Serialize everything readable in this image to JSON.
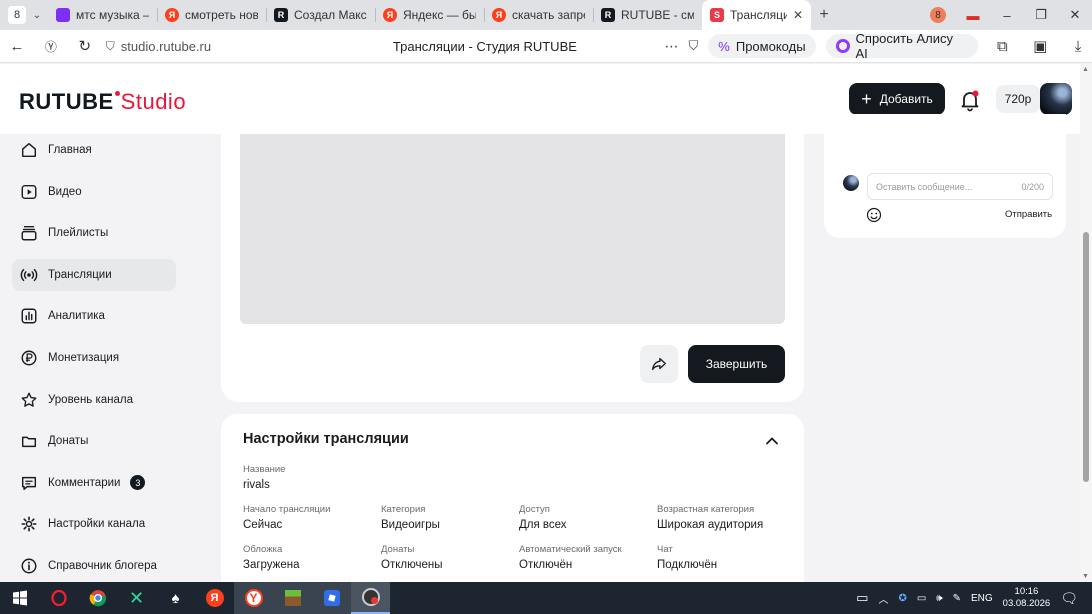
{
  "browser": {
    "tab_count": "8",
    "tabs": [
      {
        "label": "мтс музыка — Я",
        "favicon": "yandex",
        "active": false
      },
      {
        "label": "смотреть новее",
        "favicon": "yandex",
        "active": false
      },
      {
        "label": "Создал Макс к",
        "favicon": "rutube",
        "active": false
      },
      {
        "label": "Яндекс — быст",
        "favicon": "yandex",
        "active": false
      },
      {
        "label": "скачать запрет",
        "favicon": "yandex",
        "active": false
      },
      {
        "label": "RUTUBE - смот",
        "favicon": "rutube",
        "active": false
      },
      {
        "label": "Трансляции",
        "favicon": "rutube-studio",
        "active": true
      }
    ],
    "profile_letter": "8",
    "url": "studio.rutube.ru",
    "page_title": "Трансляции - Студия RUTUBE",
    "promo_label": "Промокоды",
    "alice_label": "Спросить Алису AI"
  },
  "header": {
    "logo_main": "RUTUBE",
    "logo_studio": "Studio",
    "add_label": "Добавить",
    "quality": "720p"
  },
  "sidebar": {
    "items": [
      {
        "label": "Главная",
        "icon": "home-icon"
      },
      {
        "label": "Видео",
        "icon": "video-icon"
      },
      {
        "label": "Плейлисты",
        "icon": "playlist-icon"
      },
      {
        "label": "Трансляции",
        "icon": "broadcast-icon",
        "active": true
      },
      {
        "label": "Аналитика",
        "icon": "analytics-icon"
      },
      {
        "label": "Монетизация",
        "icon": "ruble-icon"
      },
      {
        "label": "Уровень канала",
        "icon": "star-icon"
      },
      {
        "label": "Донаты",
        "icon": "gift-icon"
      },
      {
        "label": "Комментарии",
        "icon": "comment-icon",
        "badge": "3"
      },
      {
        "label": "Настройки канала",
        "icon": "gear-icon"
      },
      {
        "label": "Справочник блогера",
        "icon": "info-icon"
      }
    ]
  },
  "player": {
    "end_label": "Завершить"
  },
  "settings": {
    "title": "Настройки трансляции",
    "name_label": "Название",
    "name_value": "rivals",
    "fields": [
      {
        "label": "Начало трансляции",
        "value": "Сейчас"
      },
      {
        "label": "Категория",
        "value": "Видеоигры"
      },
      {
        "label": "Доступ",
        "value": "Для всех"
      },
      {
        "label": "Возрастная категория",
        "value": "Широкая аудитория"
      },
      {
        "label": "Обложка",
        "value": "Загружена"
      },
      {
        "label": "Донаты",
        "value": "Отключены"
      },
      {
        "label": "Автоматический запуск",
        "value": "Отключён"
      },
      {
        "label": "Чат",
        "value": "Подключён"
      }
    ]
  },
  "chat": {
    "placeholder": "Оставить сообщение...",
    "counter": "0/200",
    "send_label": "Отправить"
  },
  "taskbar": {
    "language": "ENG",
    "time": "10:16",
    "date": "03.08.2026"
  },
  "colors": {
    "brand_red": "#ed143b",
    "dark": "#14191f",
    "active_item": "#e7e8ea"
  }
}
